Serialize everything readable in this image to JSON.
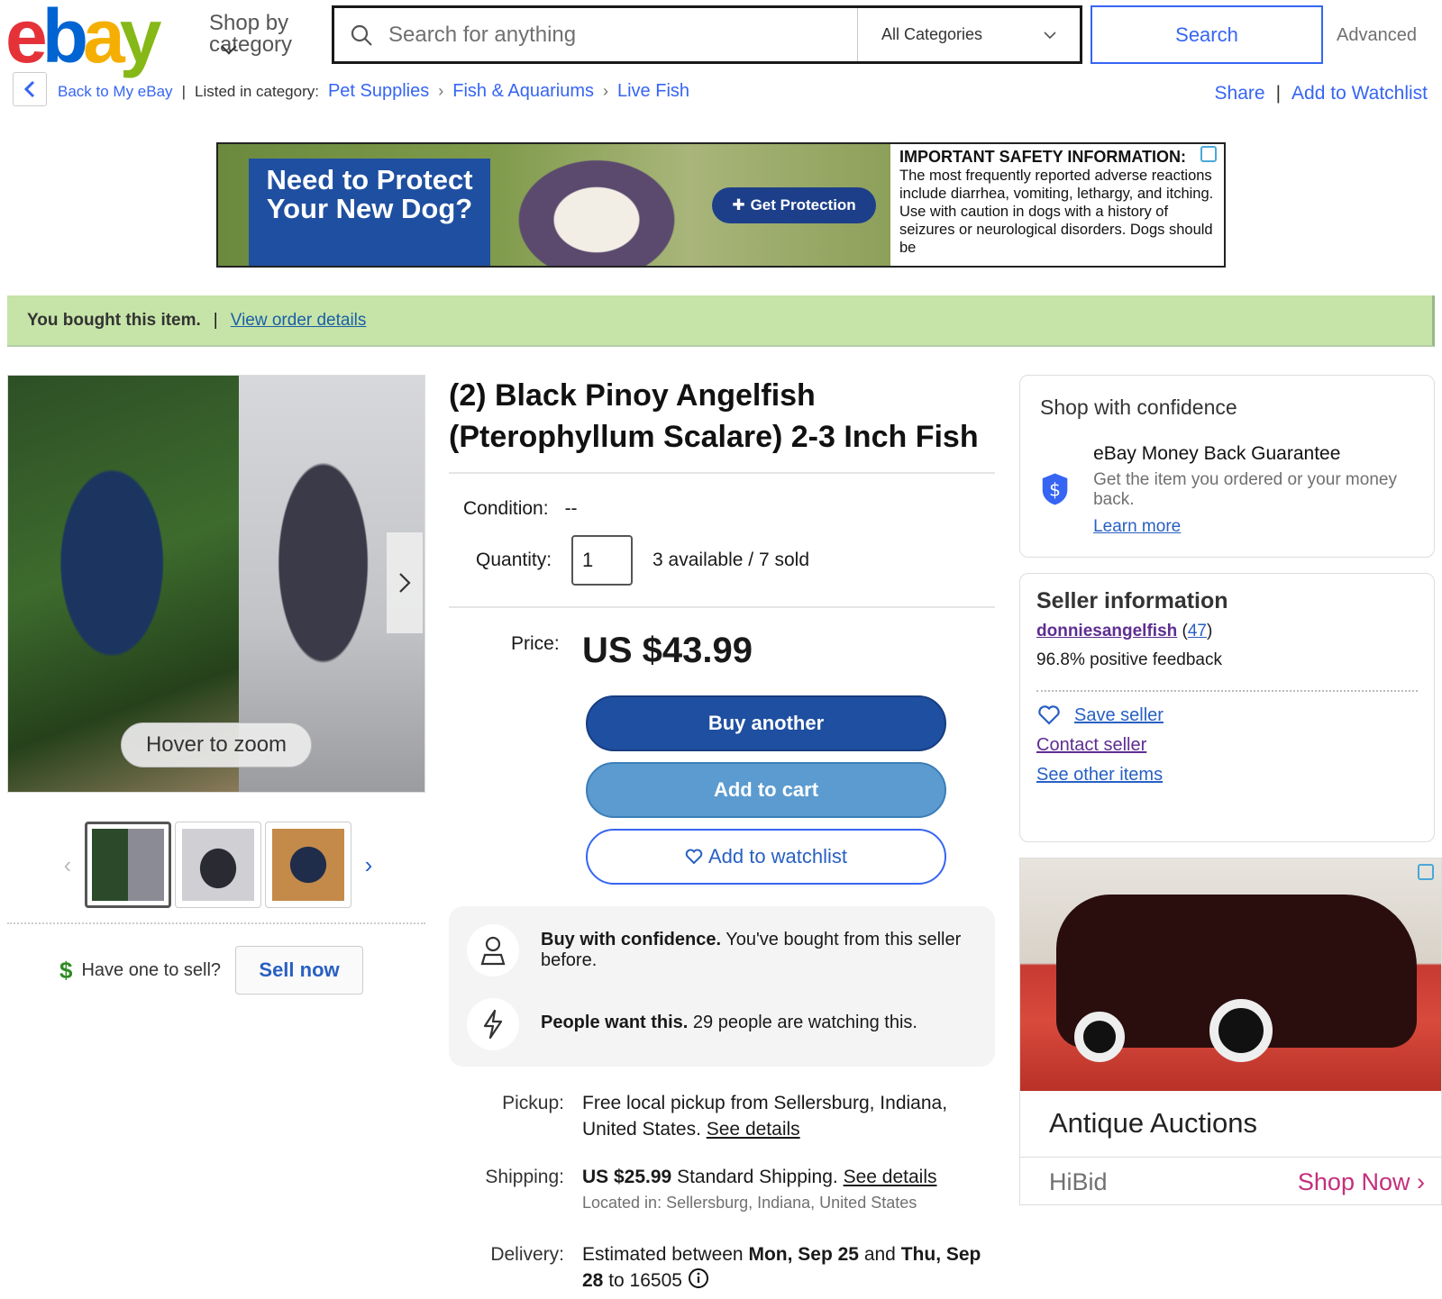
{
  "header": {
    "logo": "ebay",
    "shop_by_category": "Shop by category",
    "search_placeholder": "Search for anything",
    "category_select": "All Categories",
    "search_button": "Search",
    "advanced": "Advanced"
  },
  "breadcrumb": {
    "back": "Back to My eBay",
    "listed_in": "Listed in category:",
    "categories": [
      "Pet Supplies",
      "Fish & Aquariums",
      "Live Fish"
    ],
    "share": "Share",
    "add_to_watchlist": "Add to Watchlist"
  },
  "ad_banner": {
    "headline": "Need to Protect Your New Dog?",
    "cta": "Get Protection",
    "safety_title": "IMPORTANT SAFETY INFORMATION:",
    "safety_text": "The most frequently reported adverse reactions include diarrhea, vomiting, lethargy, and itching. Use with caution in dogs with a history of seizures or neurological disorders. Dogs should be"
  },
  "bought_bar": {
    "text": "You bought this item.",
    "link": "View order details"
  },
  "gallery": {
    "hover_to_zoom": "Hover to zoom",
    "have_one_to_sell": "Have one to sell?",
    "sell_now": "Sell now"
  },
  "item": {
    "title": "(2) Black Pinoy Angelfish (Pterophyllum Scalare) 2-3 Inch Fish",
    "condition_label": "Condition:",
    "condition_value": "--",
    "quantity_label": "Quantity:",
    "quantity_value": "1",
    "availability": "3 available / 7 sold",
    "price_label": "Price:",
    "price": "US $43.99",
    "buy_another": "Buy another",
    "add_to_cart": "Add to cart",
    "add_to_watchlist": "Add to watchlist"
  },
  "confidence": {
    "row1_bold": "Buy with confidence.",
    "row1_text": "You've bought from this seller before.",
    "row2_bold": "People want this.",
    "row2_text": "29 people are watching this."
  },
  "details": {
    "pickup_label": "Pickup:",
    "pickup_text": "Free local pickup from Sellersburg, Indiana, United States.",
    "pickup_link": "See details",
    "shipping_label": "Shipping:",
    "shipping_price": "US $25.99",
    "shipping_text": "Standard Shipping.",
    "shipping_link": "See details",
    "located_in": "Located in: Sellersburg, Indiana, United States",
    "delivery_label": "Delivery:",
    "delivery_pre": "Estimated between",
    "delivery_start": "Mon, Sep 25",
    "delivery_and": "and",
    "delivery_end": "Thu, Sep 28",
    "delivery_to": "to 16505"
  },
  "shop_confidence": {
    "heading": "Shop with confidence",
    "guarantee_title": "eBay Money Back Guarantee",
    "guarantee_text": "Get the item you ordered or your money back.",
    "learn_more": "Learn more"
  },
  "seller": {
    "heading": "Seller information",
    "name": "donniesangelfish",
    "count_open": "(",
    "count": "47",
    "count_close": ")",
    "feedback": "96.8% positive feedback",
    "save_seller": "Save seller",
    "contact_seller": "Contact seller",
    "see_other_items": "See other items"
  },
  "side_ad": {
    "title": "Antique Auctions",
    "brand": "HiBid",
    "cta": "Shop Now"
  },
  "colors": {
    "brand_blue": "#3665f3",
    "buy_button": "#1f4fa0",
    "cart_button": "#5b9bd0",
    "bought_bar": "#c6e4a7",
    "shop_now": "#c42f7c"
  }
}
